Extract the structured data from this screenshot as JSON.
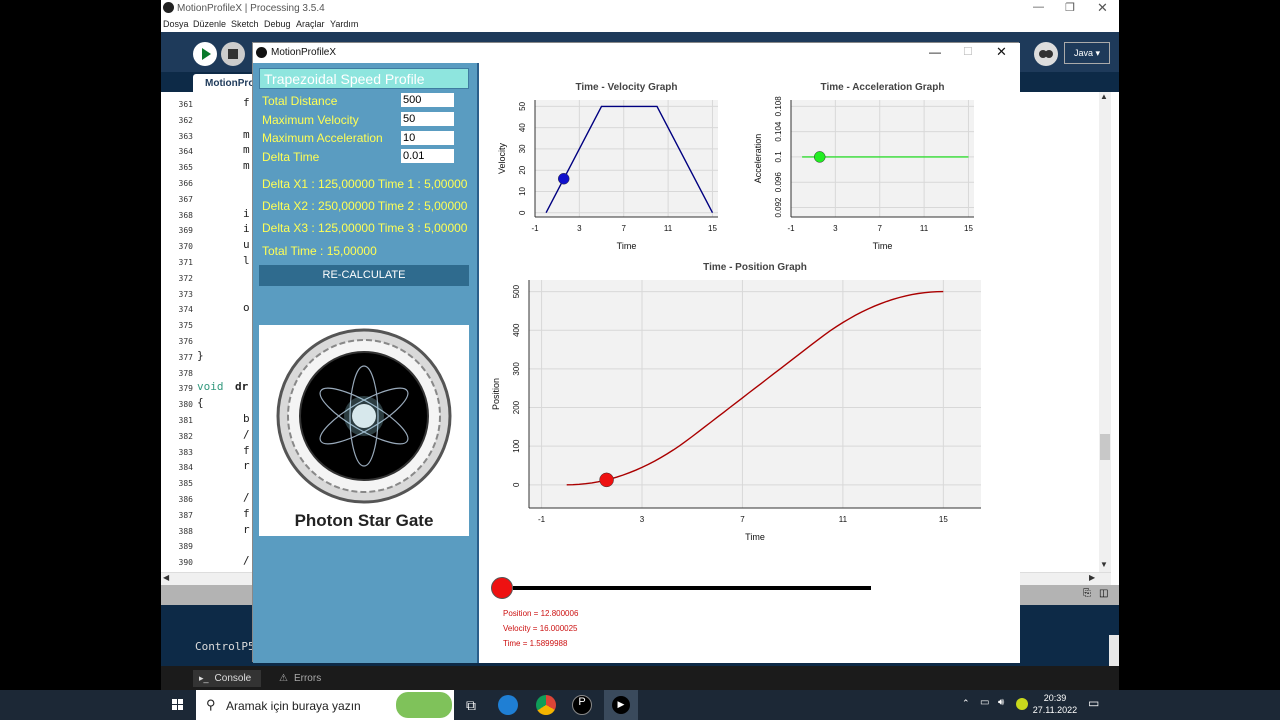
{
  "ide": {
    "title": "MotionProfileX | Processing 3.5.4",
    "menu": [
      "Dosya",
      "Düzenle",
      "Sketch",
      "Debug",
      "Araçlar",
      "Yardım"
    ],
    "mode": "Java ▾",
    "tab": "MotionPro",
    "console_text": "ControlP5",
    "console_tab": "Console",
    "errors_tab": "Errors",
    "lines": [
      "361",
      "362",
      "363",
      "364",
      "365",
      "366",
      "367",
      "368",
      "369",
      "370",
      "371",
      "372",
      "373",
      "374",
      "375",
      "376",
      "377",
      "378",
      "379",
      "380",
      "381",
      "382",
      "383",
      "384",
      "385",
      "386",
      "387",
      "388",
      "389",
      "390"
    ],
    "code": {
      "l361": "f",
      "l363": "m",
      "l364": "m",
      "l365": "m",
      "l368": "i",
      "l369": "i",
      "l370": "u",
      "l371": "l",
      "l374": "o",
      "l377": "}",
      "l379_kw": "void",
      "l379_fn": "dr",
      "l380": "{",
      "l381": "b",
      "l382": "/",
      "l383": "f",
      "l384": "r",
      "l386": "/",
      "l387": "f",
      "l388": "r",
      "l390": "/"
    }
  },
  "sketch": {
    "title": "MotionProfileX",
    "panel": {
      "profile_title": "Trapezoidal Speed Profile",
      "total_distance_label": "Total Distance",
      "total_distance_value": "500",
      "max_velocity_label": "Maximum Velocity",
      "max_velocity_value": "50",
      "max_accel_label": "Maximum Acceleration",
      "max_accel_value": "10",
      "delta_time_label": "Delta Time",
      "delta_time_value": "0.01",
      "delta_x1": "Delta X1 : 125,00000  Time 1 : 5,00000",
      "delta_x2": "Delta X2 : 250,00000  Time 2 : 5,00000",
      "delta_x3": "Delta X3 : 125,00000  Time 3 : 5,00000",
      "total_time": "Total Time : 15,00000",
      "recalc_label": "RE-CALCULATE",
      "logo_text": "Photon Star Gate"
    },
    "info": {
      "position": "Position = 12.800006",
      "velocity": "Velocity = 16.000025",
      "time": "Time = 1.5899988"
    },
    "slider_value": 0
  },
  "taskbar": {
    "search_placeholder": "Aramak için buraya yazın",
    "time": "20:39",
    "date": "27.11.2022"
  },
  "colors": {
    "panel_bg": "#5a9cc1",
    "label_yellow": "#ffff55",
    "velocity_line": "#000080",
    "accel_line": "#33dd33",
    "position_line": "#aa0000"
  },
  "chart_data": [
    {
      "type": "line",
      "title": "Time  -  Velocity Graph",
      "xlabel": "Time",
      "ylabel": "Velocity",
      "xticks": [
        "-1",
        "3",
        "7",
        "11",
        "15"
      ],
      "yticks": [
        "0",
        "10",
        "20",
        "30",
        "40",
        "50"
      ],
      "xlim": [
        -1,
        15.5
      ],
      "ylim": [
        -2,
        53
      ],
      "x": [
        0,
        5,
        10,
        15
      ],
      "values": [
        0,
        50,
        50,
        0
      ],
      "marker": {
        "x": 1.59,
        "y": 16
      },
      "grid": true
    },
    {
      "type": "line",
      "title": "Time  -  Acceleration Graph",
      "xlabel": "Time",
      "ylabel": "Acceleration",
      "xticks": [
        "-1",
        "3",
        "7",
        "11",
        "15"
      ],
      "yticks": [
        "0.092",
        "0.096",
        "0.1",
        "0.104",
        "0.108"
      ],
      "xlim": [
        -1,
        15.5
      ],
      "ylim": [
        0.0905,
        0.109
      ],
      "x": [
        0,
        15
      ],
      "values": [
        0.1,
        0.1
      ],
      "marker": {
        "x": 1.59,
        "y": 0.1
      },
      "grid": true
    },
    {
      "type": "line",
      "title": "Time -  Position Graph",
      "xlabel": "Time",
      "ylabel": "Position",
      "xticks": [
        "-1",
        "3",
        "7",
        "11",
        "15"
      ],
      "yticks": [
        "0",
        "100",
        "200",
        "300",
        "400",
        "500"
      ],
      "xlim": [
        -1.5,
        16.5
      ],
      "ylim": [
        -60,
        530
      ],
      "x": [
        0,
        1,
        2,
        3,
        4,
        5,
        6,
        7,
        8,
        9,
        10,
        11,
        12,
        13,
        14,
        15
      ],
      "values": [
        0,
        5,
        20,
        45,
        80,
        125,
        175,
        225,
        275,
        325,
        375,
        420,
        455,
        480,
        495,
        500
      ],
      "marker": {
        "x": 1.59,
        "y": 12.8
      },
      "grid": true
    }
  ]
}
